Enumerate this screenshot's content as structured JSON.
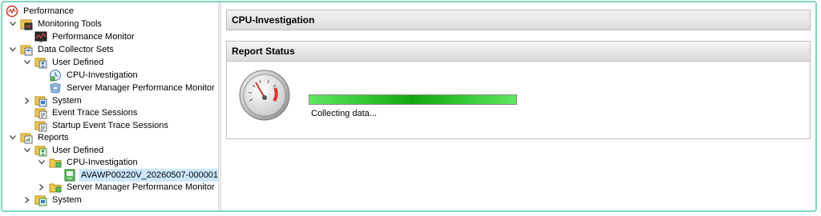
{
  "tree": {
    "root": "Performance",
    "monitoring_tools": "Monitoring Tools",
    "performance_monitor": "Performance Monitor",
    "data_collector_sets": "Data Collector Sets",
    "user_defined": "User Defined",
    "cpu_investigation": "CPU-Investigation",
    "server_manager_pm": "Server Manager Performance Monitor",
    "system": "System",
    "event_trace_sessions": "Event Trace Sessions",
    "startup_event_trace_sessions": "Startup Event Trace Sessions",
    "reports": "Reports",
    "reports_user_defined": "User Defined",
    "reports_cpu_investigation": "CPU-Investigation",
    "report_item": "AVAWP00220V_20260507-000001",
    "reports_server_manager_pm": "Server Manager Performance Monitor",
    "reports_system": "System"
  },
  "main": {
    "title": "CPU-Investigation",
    "report_status_title": "Report Status",
    "status_text": "Collecting data...",
    "progress": 1.0
  },
  "icons": {
    "performance": "performance-icon",
    "folder": "folder-icon",
    "monitor": "performance-monitor-icon",
    "data_collector": "data-collector-icon",
    "report": "report-icon",
    "gauge": "gauge-icon"
  }
}
